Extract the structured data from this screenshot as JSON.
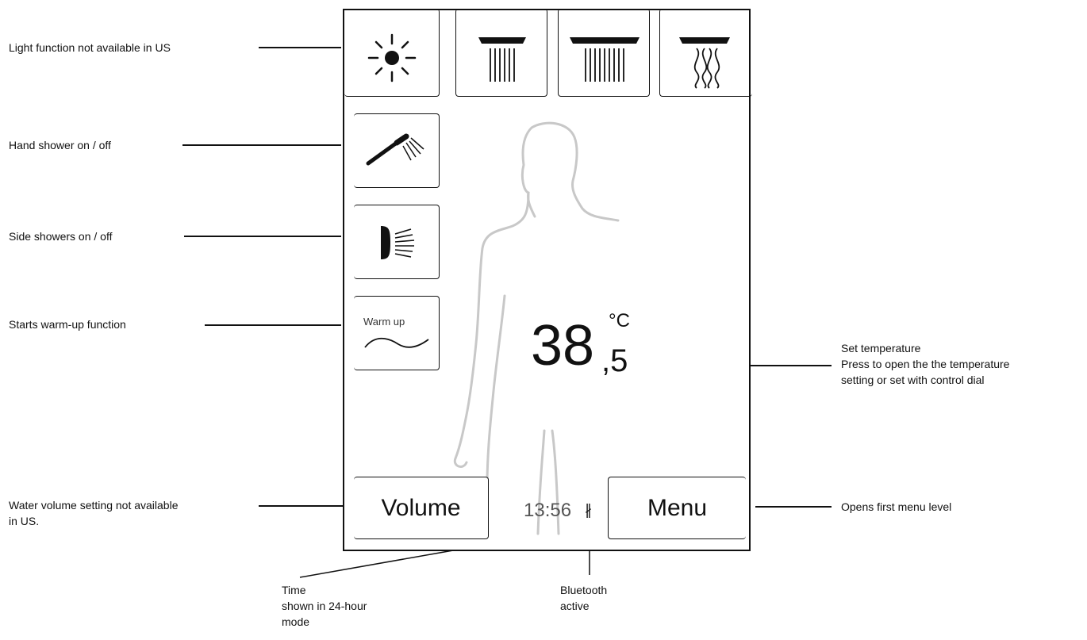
{
  "annotations": {
    "light": "Light function not available in US",
    "hand_shower": "Hand shower on / off",
    "side_showers": "Side showers on / off",
    "warm_up_fn": "Starts warm-up function",
    "volume_line1": "Water volume setting not available",
    "volume_line2": "in US.",
    "set_temp_line1": "Set temperature",
    "set_temp_line2": "Press to open the the temperature",
    "set_temp_line3": "setting or set with control dial",
    "menu_level": "Opens first menu level",
    "time_line1": "Time",
    "time_line2": "shown in 24-hour",
    "time_line3": "mode",
    "bt_line1": "Bluetooth",
    "bt_line2": "active"
  },
  "display": {
    "warm_up_label": "Warm up",
    "temperature_int": "38",
    "temperature_dec": ",5",
    "temperature_unit": "°C",
    "volume_label": "Volume",
    "menu_label": "Menu",
    "time": "13:56",
    "bluetooth_glyph": "∦"
  },
  "icons": {
    "light": "sun-icon",
    "overhead_narrow": "overhead-shower-narrow-icon",
    "overhead_wide": "overhead-shower-wide-icon",
    "overhead_massage": "overhead-shower-wave-icon",
    "hand_shower": "hand-shower-icon",
    "side_shower": "side-shower-icon",
    "warm_up": "wave-icon",
    "bluetooth": "bluetooth-icon"
  },
  "colors": {
    "border": "#111111",
    "figure": "#c8c8c8"
  }
}
